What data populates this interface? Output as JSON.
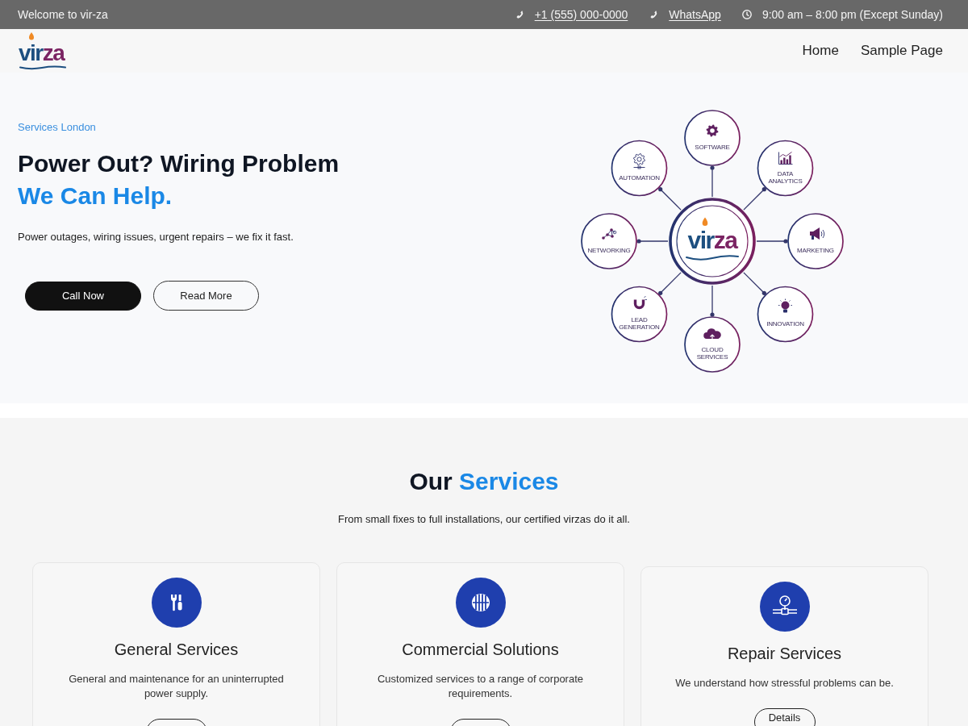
{
  "top_bar": {
    "welcome": "Welcome to vir-za",
    "contacts": [
      {
        "kind": "phone",
        "text": "+1 (555) 000-0000",
        "link": true
      },
      {
        "kind": "phone",
        "text": "WhatsApp",
        "link": true
      },
      {
        "kind": "clock",
        "text": "9:00 am – 8:00 pm (Except Sunday)",
        "link": false
      }
    ]
  },
  "header": {
    "logo": [
      "vir",
      "za"
    ],
    "nav": [
      "Home",
      "Sample Page"
    ]
  },
  "hero": {
    "eyebrow": "Services London",
    "title": "Power Out? Wiring Problem",
    "title_highlight": "We Can Help.",
    "text": "Power outages, wiring issues, urgent repairs – we fix it fast.",
    "buttons": [
      {
        "label": "Call Now",
        "kind": "filled"
      },
      {
        "label": "Read More",
        "kind": "outline"
      }
    ],
    "diagram": {
      "logo": [
        "vir",
        "za"
      ],
      "nodes": [
        {
          "label": "SOFTWARE"
        },
        {
          "label": "DATA ANALYTICS"
        },
        {
          "label": "MARKETING"
        },
        {
          "label": "INNOVATION"
        },
        {
          "label": "CLOUD SERVICES"
        },
        {
          "label": "LEAD GENERATION"
        },
        {
          "label": "NETWORKING"
        },
        {
          "label": "AUTOMATION"
        }
      ]
    }
  },
  "services": {
    "title": "Our",
    "title_highlight": "Services",
    "subtitle": "From small fixes to full installations, our certified virzas do it all.",
    "cards": [
      {
        "title": "General Services",
        "text": "General and maintenance for an uninterrupted power supply.",
        "has_button": true
      },
      {
        "title": "Commercial Solutions",
        "text": "Customized services to a range of corporate requirements.",
        "has_button": true
      },
      {
        "title": "Repair Services",
        "text": "We understand how stressful problems can be.",
        "has_button": true,
        "button_label": "Details"
      }
    ]
  }
}
